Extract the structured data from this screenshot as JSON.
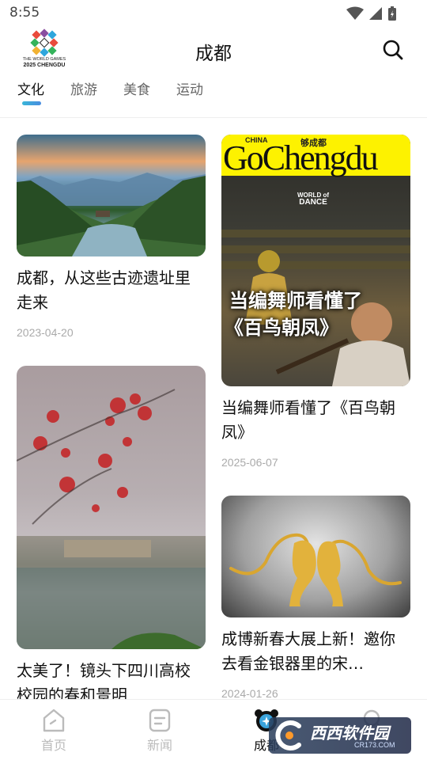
{
  "status_bar": {
    "time": "8:55"
  },
  "header": {
    "logo_line1": "THE WORLD GAMES",
    "logo_line2": "2025 CHENGDU",
    "title": "成都"
  },
  "tabs": [
    {
      "label": "文化",
      "active": true
    },
    {
      "label": "旅游",
      "active": false
    },
    {
      "label": "美食",
      "active": false
    },
    {
      "label": "运动",
      "active": false
    }
  ],
  "feed": {
    "left": [
      {
        "title": "成都，从这些古迹遗址里走来",
        "date": "2023-04-20"
      },
      {
        "title": "太美了！镜头下四川高校校园的春和景明",
        "date": ""
      }
    ],
    "right": [
      {
        "title": "当编舞师看懂了《百鸟朝凤》",
        "date": "2025-06-07",
        "image_text": {
          "china": "CHINA",
          "small": "够成都",
          "brand": "GoChengdu",
          "badge_line1": "WORLD of",
          "badge_line2": "DANCE",
          "overlay_line1": "当编舞师看懂了",
          "overlay_line2": "《百鸟朝凤》"
        }
      },
      {
        "title": "成博新春大展上新！邀你去看金银器里的宋…",
        "date": "2024-01-26"
      }
    ]
  },
  "bottom_nav": [
    {
      "label": "首页",
      "icon": "home-icon",
      "active": false
    },
    {
      "label": "新闻",
      "icon": "news-icon",
      "active": false
    },
    {
      "label": "成都",
      "icon": "panda-icon",
      "active": true
    },
    {
      "label": "",
      "icon": "search-icon",
      "active": false
    }
  ],
  "watermark": {
    "text": "西西软件园",
    "url": "CR173.COM"
  },
  "colors": {
    "accent": "#3ba3dc",
    "text": "#111111",
    "muted": "#aaaaaa"
  }
}
